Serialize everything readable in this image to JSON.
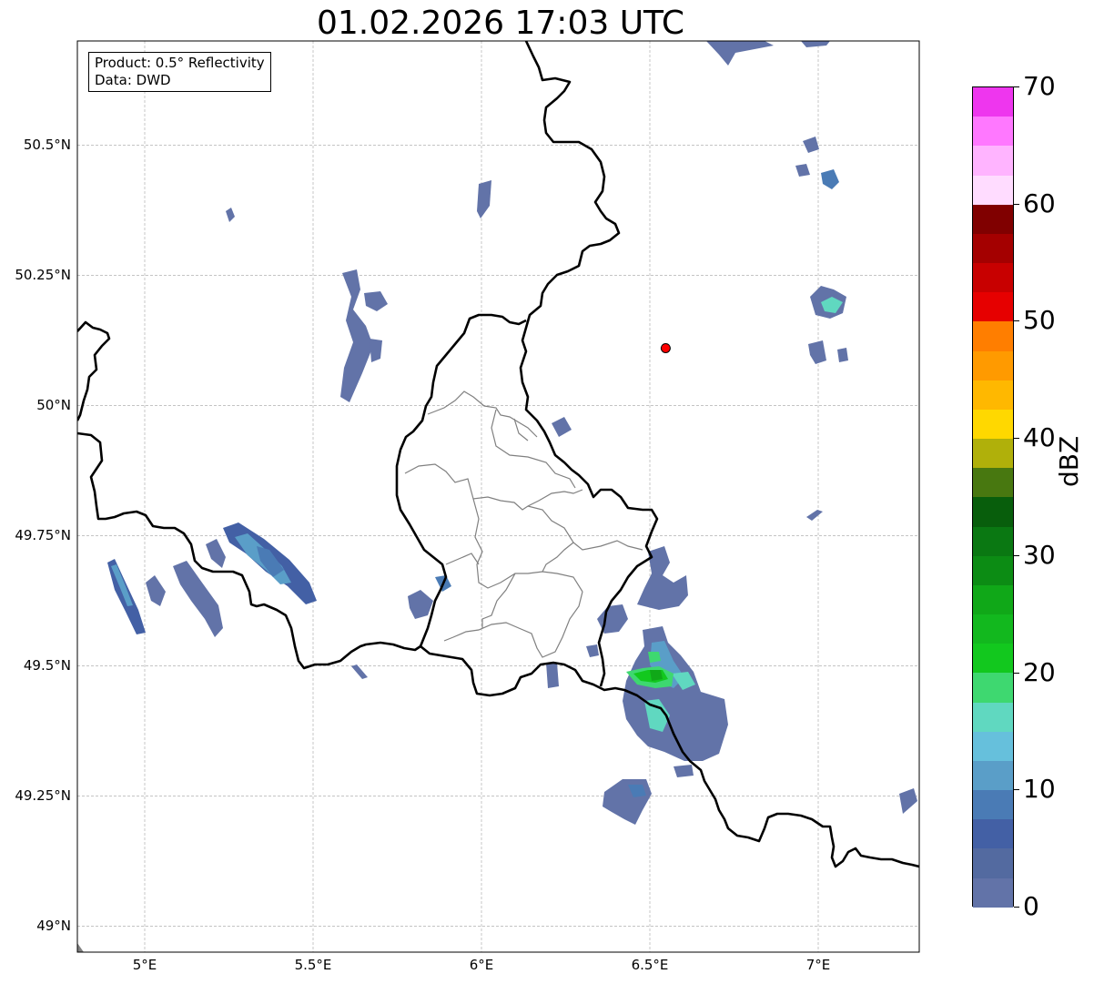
{
  "title": "01.02.2026 17:03 UTC",
  "info": {
    "product": "Product: 0.5° Reflectivity",
    "data": "Data: DWD"
  },
  "axes": {
    "lon_range": [
      4.8,
      7.3
    ],
    "lat_range": [
      48.95,
      50.7
    ],
    "lon_ticks": [
      {
        "value": 5.0,
        "label": "5°E"
      },
      {
        "value": 5.5,
        "label": "5.5°E"
      },
      {
        "value": 6.0,
        "label": "6°E"
      },
      {
        "value": 6.5,
        "label": "6.5°E"
      },
      {
        "value": 7.0,
        "label": "7°E"
      }
    ],
    "lat_ticks": [
      {
        "value": 50.5,
        "label": "50.5°N"
      },
      {
        "value": 50.25,
        "label": "50.25°N"
      },
      {
        "value": 50.0,
        "label": "50°N"
      },
      {
        "value": 49.75,
        "label": "49.75°N"
      },
      {
        "value": 49.5,
        "label": "49.5°N"
      },
      {
        "value": 49.25,
        "label": "49.25°N"
      },
      {
        "value": 49.0,
        "label": "49°N"
      }
    ],
    "grid": true
  },
  "colorbar": {
    "label": "dBZ",
    "min": 0,
    "max": 70,
    "ticks": [
      0,
      10,
      20,
      30,
      40,
      50,
      60,
      70
    ],
    "colors": [
      "#6273a8",
      "#536aa0",
      "#4360a5",
      "#4a7bb5",
      "#5a9ec8",
      "#66c0dc",
      "#60d8c0",
      "#3ed870",
      "#12c81e",
      "#12b81e",
      "#10a818",
      "#0c8c14",
      "#0a7812",
      "#085e0c",
      "#487810",
      "#b0b00a",
      "#ffd800",
      "#ffb800",
      "#ff9a00",
      "#ff7e00",
      "#e60000",
      "#c80000",
      "#a40000",
      "#800000",
      "#ffdcff",
      "#ffb4ff",
      "#ff78ff",
      "#ee36ee"
    ]
  },
  "radar_site": {
    "lon": 6.547,
    "lat": 50.11,
    "color": "#ff0000"
  },
  "echo_levels_dbz": [
    2,
    5,
    8,
    10,
    13,
    16,
    19,
    22,
    25
  ]
}
